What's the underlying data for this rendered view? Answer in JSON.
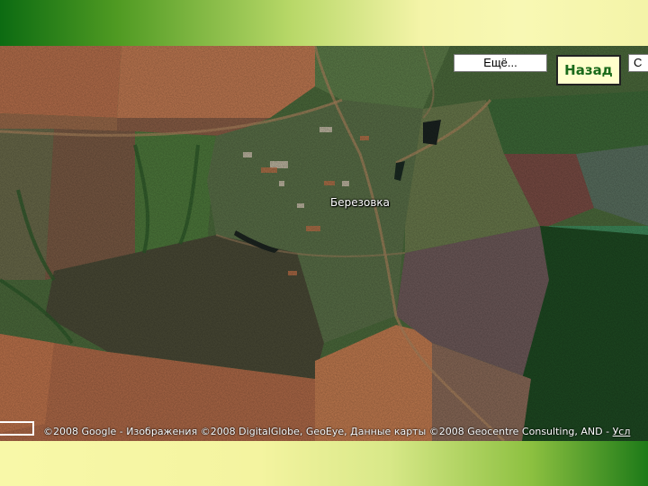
{
  "map": {
    "place_label": "Березовка",
    "copyright": "©2008 Google - Изображения ©2008 DigitalGlobe, GeoEye, Данные карты ©2008 Geocentre Consulting, AND - ",
    "terms_link": "Усл"
  },
  "controls": {
    "more_label": "Ещё...",
    "back_label": "Назад",
    "clipped_button_label": "С"
  },
  "colors": {
    "slide_green": "#0c6b12",
    "slide_yellow": "#f8f8b4",
    "back_button_bg": "#ffffcc",
    "back_button_text": "#1a6a1a"
  },
  "icons": [
    "scale-bar-icon"
  ]
}
